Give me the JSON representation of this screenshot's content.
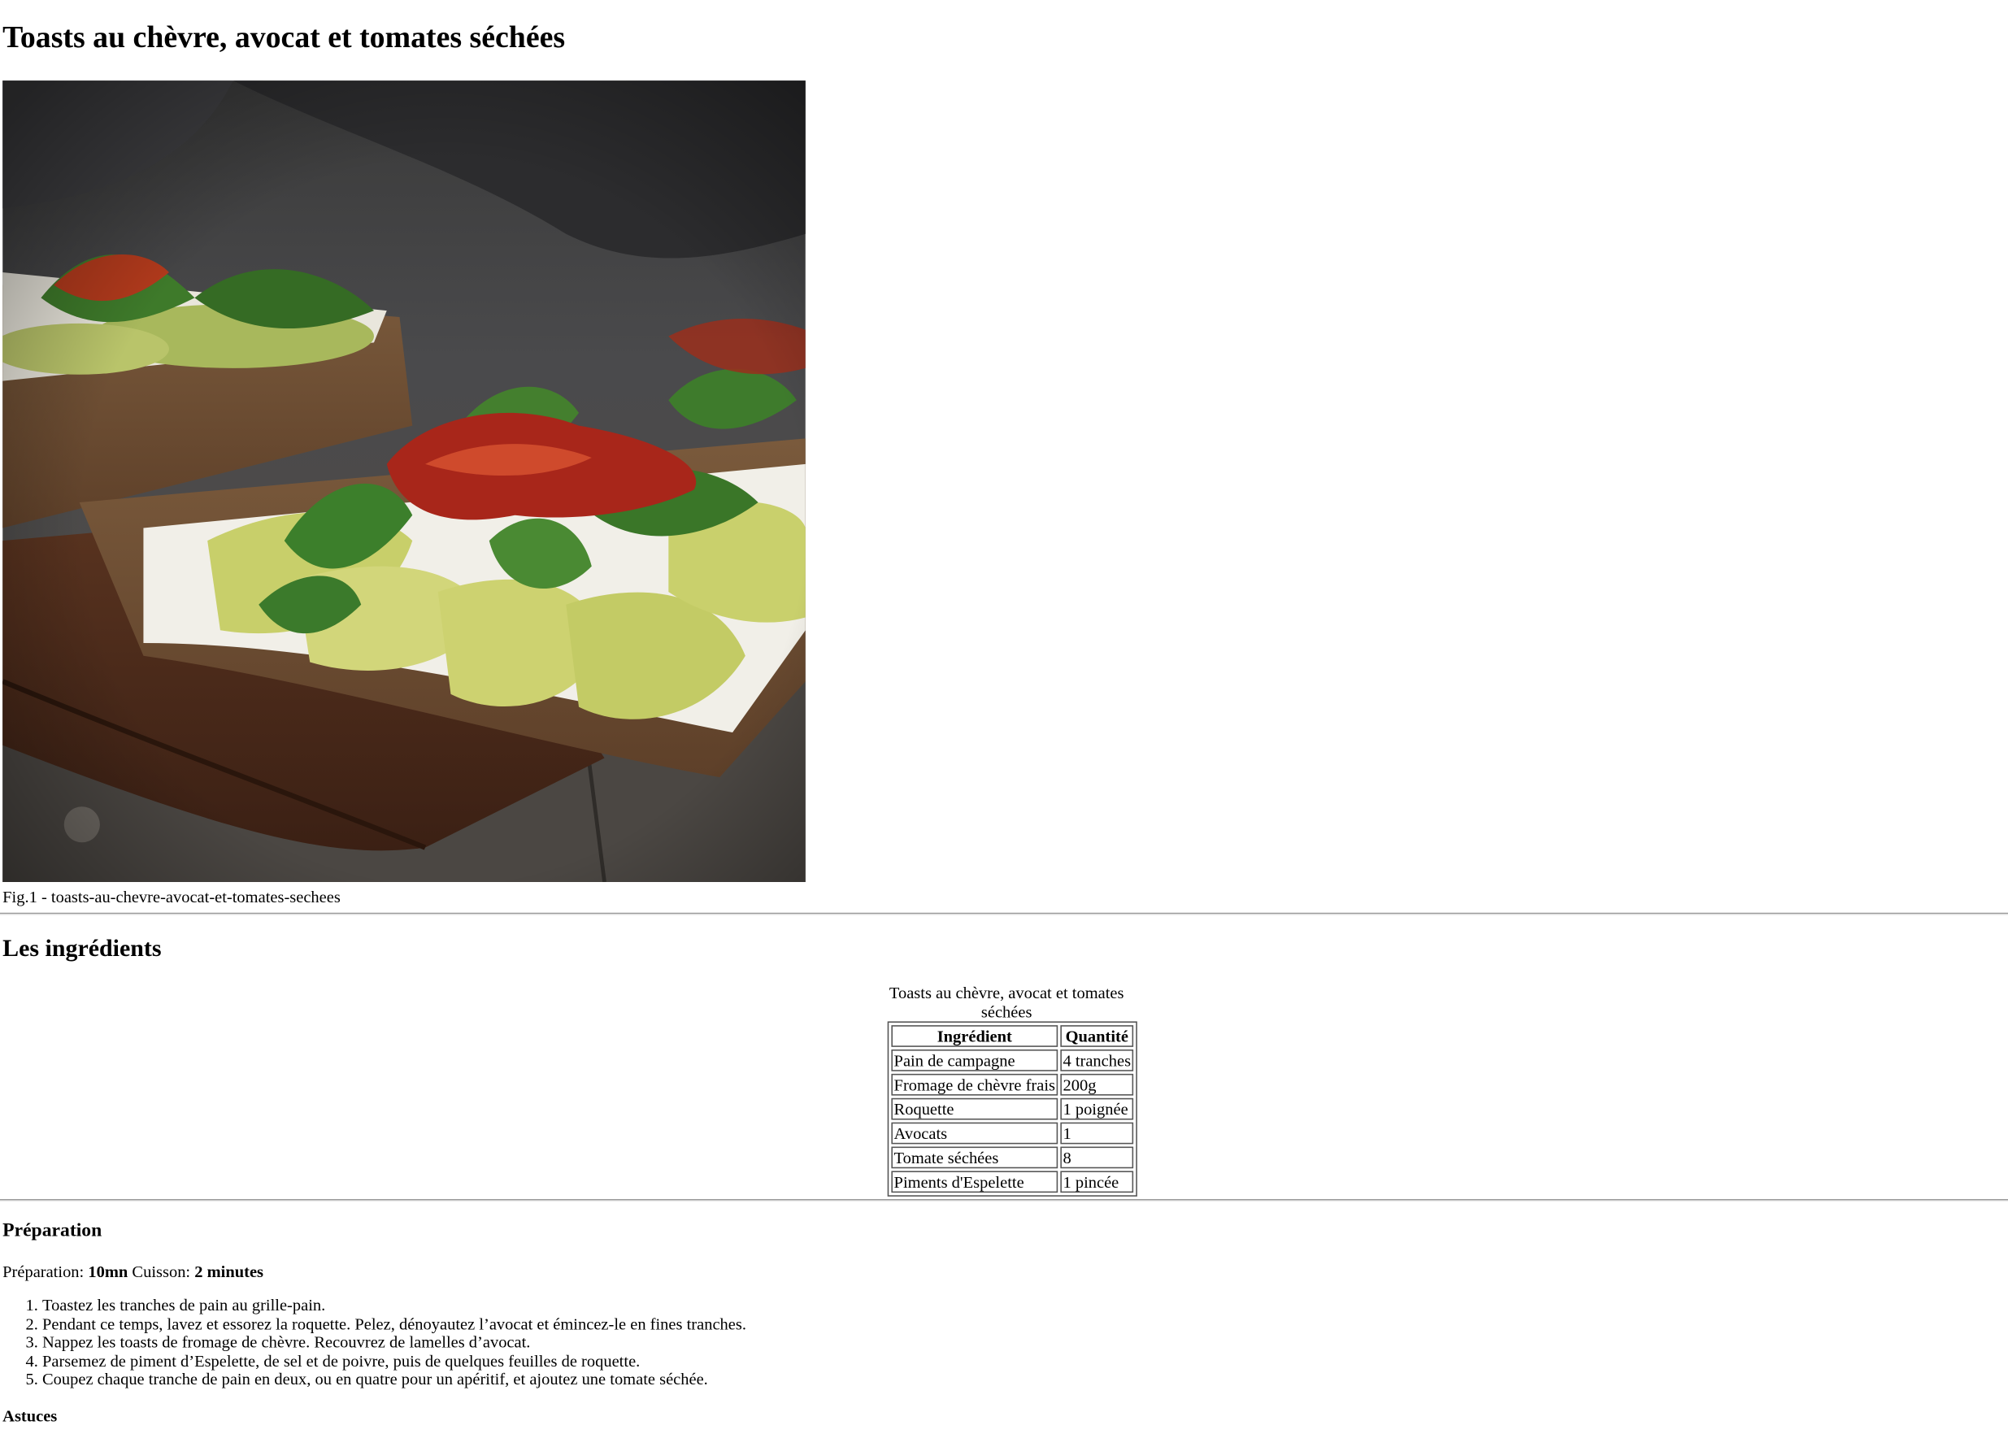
{
  "recipe": {
    "title": "Toasts au chèvre, avocat et tomates séchées",
    "figure_caption": "Fig.1 - toasts-au-chevre-avocat-et-tomates-sechees"
  },
  "ingredients": {
    "heading": "Les ingrédients",
    "table_caption": "Toasts au chèvre, avocat et tomates séchées",
    "headers": {
      "ingredient": "Ingrédient",
      "quantity": "Quantité"
    },
    "rows": [
      {
        "name": "Pain de campagne",
        "qty": "4 tranches"
      },
      {
        "name": "Fromage de chèvre frais",
        "qty": "200g"
      },
      {
        "name": "Roquette",
        "qty": "1 poignée"
      },
      {
        "name": "Avocats",
        "qty": "1"
      },
      {
        "name": "Tomate séchées",
        "qty": "8"
      },
      {
        "name": "Piments d'Espelette",
        "qty": "1 pincée"
      }
    ]
  },
  "preparation": {
    "heading": "Préparation",
    "prep_label": "Préparation: ",
    "prep_value": "10mn",
    "cook_label": " Cuisson: ",
    "cook_value": "2 minutes",
    "steps": [
      "Toastez les tranches de pain au grille-pain.",
      "Pendant ce temps, lavez et essorez la roquette. Pelez, dénoyautez l’avocat et émincez-le en fines tranches.",
      "Nappez les toasts de fromage de chèvre. Recouvrez de lamelles d’avocat.",
      "Parsemez de piment d’Espelette, de sel et de poivre, puis de quelques feuilles de roquette.",
      "Coupez chaque tranche de pain en deux, ou en quatre pour un apéritif, et ajoutez une tomate séchée."
    ]
  },
  "tips": {
    "heading": "Astuces"
  }
}
